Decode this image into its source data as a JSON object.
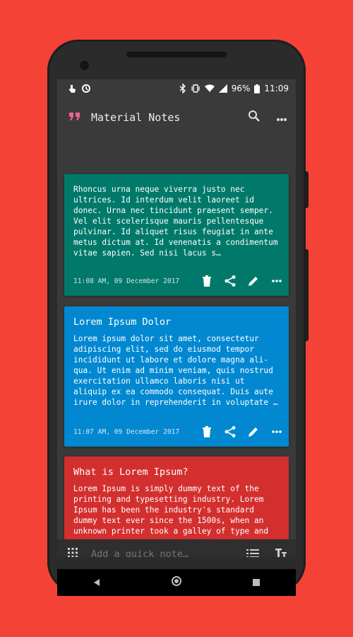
{
  "status_bar": {
    "battery": "96%",
    "time": "11:09"
  },
  "app_bar": {
    "title": "Material Notes"
  },
  "notes": [
    {
      "title": "",
      "body": "Rhoncus urna neque viverra justo nec ultrices. Id interdum velit laoreet id donec. Urna nec tincidunt praesent semper. Vel elit scelerisque mauris pellentesque pulvinar. Id aliquet risus feugiat in ante metus dictum at. Id venenatis a condimentum vitae sapien. Sed nisi lacus s…",
      "date": "11:08 AM, 09 December 2017",
      "color": "#00796b"
    },
    {
      "title": "Lorem Ipsum Dolor",
      "body": "Lorem ipsum dolor sit amet, consectetur adipiscing elit, sed do eiusmod tempor incididunt ut labore et dolore magna ali-qua. Ut enim ad minim veniam, quis nostrud exercitation ullamco laboris nisi ut aliquip ex ea commodo consequat. Duis aute irure dolor in reprehenderit in voluptate …",
      "date": "11:07 AM, 09 December 2017",
      "color": "#0288d1"
    },
    {
      "title": "What is Lorem Ipsum?",
      "body": "Lorem Ipsum is simply dummy text of the printing and typesetting industry. Lorem Ipsum has been the industry's standard dummy text ever since the 1500s, when an unknown printer took a galley of type and",
      "date": "",
      "color": "#d32f2f"
    }
  ],
  "quick_note": {
    "placeholder": "Add a quick note…"
  },
  "colors": {
    "background": "#f44336",
    "accent": "#f06292",
    "screen": "#3a3a3a"
  },
  "icons": {
    "app": "quote-icon",
    "search": "search-icon",
    "menu": "more-vert-icon",
    "delete": "trash-icon",
    "share": "share-icon",
    "edit": "pencil-icon",
    "more": "more-horiz-icon",
    "grid": "grid-icon",
    "list": "list-icon",
    "text": "text-size-icon"
  }
}
